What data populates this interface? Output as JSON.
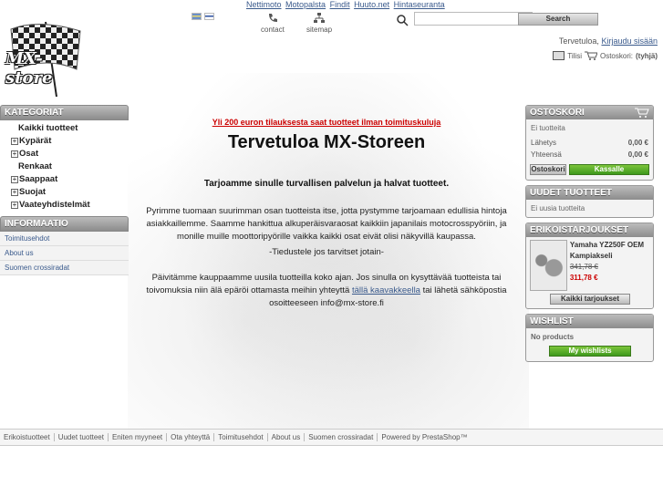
{
  "top_links": [
    "Nettimoto",
    "Motopalsta",
    "Findit",
    "Huuto.net",
    "Hintaseuranta"
  ],
  "top_icons": {
    "contact": "contact",
    "sitemap": "sitemap"
  },
  "logo_text": "MX-store",
  "search": {
    "value": "",
    "button": "Search"
  },
  "header": {
    "welcome": "Tervetuloa,",
    "login": "Kirjaudu sisään",
    "account": "Tilisi",
    "cart_label": "Ostoskori:",
    "cart_state": "(tyhjä)"
  },
  "left": {
    "categories_title": "KATEGORIAT",
    "categories": [
      {
        "label": "Kaikki tuotteet",
        "expand": false
      },
      {
        "label": "Kypärät",
        "expand": true
      },
      {
        "label": "Osat",
        "expand": true
      },
      {
        "label": "Renkaat",
        "expand": false
      },
      {
        "label": "Saappaat",
        "expand": true
      },
      {
        "label": "Suojat",
        "expand": true
      },
      {
        "label": "Vaateyhdistelmät",
        "expand": true
      }
    ],
    "info_title": "INFORMAATIO",
    "info": [
      "Toimitusehdot",
      "About us",
      "Suomen crossiradat"
    ]
  },
  "main": {
    "promo": "Yli 200 euron tilauksesta saat tuotteet ilman toimituskuluja",
    "title": "Tervetuloa MX-Storeen",
    "lead": "Tarjoamme sinulle turvallisen palvelun ja halvat tuotteet.",
    "para1": "Pyrimme tuomaan suurimman osan tuotteista itse, jotta pystymme tarjoamaan edullisia hintoja asiakkaillemme. Saamme hankittua alkuperäisvaraosat kaikkiin japanilais motocrosspyöriin, ja monille muille moottoripyörille vaikka kaikki osat eivät olisi näkyvillä kaupassa.",
    "para2": "-Tiedustele jos tarvitset jotain-",
    "para3a": "Päivitämme kauppaamme uusila tuotteilla koko ajan. Jos sinulla on kysyttävää tuotteista tai toivomuksia niin älä epäröi ottamasta meihin yhteyttä",
    "para3_link": "tällä kaavakkeella",
    "para3b": "tai lähetä sähköpostia osoitteeseen info@mx-store.fi"
  },
  "right": {
    "cart_title": "OSTOSKORI",
    "cart_empty": "Ei tuotteita",
    "shipping_label": "Lähetys",
    "shipping_value": "0,00 €",
    "total_label": "Yhteensä",
    "total_value": "0,00 €",
    "cart_btn": "Ostoskori",
    "checkout_btn": "Kassalle",
    "new_title": "UUDET TUOTTEET",
    "new_empty": "Ei uusia tuotteita",
    "specials_title": "ERIKOISTARJOUKSET",
    "special_name": "Yamaha YZ250F OEM Kampiakseli",
    "special_old": "341,78 €",
    "special_new": "311,78 €",
    "all_specials": "Kaikki tarjoukset",
    "wishlist_title": "WISHLIST",
    "wishlist_empty": "No products",
    "wishlist_btn": "My wishlists"
  },
  "footer": [
    "Erikoistuotteet",
    "Uudet tuotteet",
    "Eniten myyneet",
    "Ota yhteyttä",
    "Toimitusehdot",
    "About us",
    "Suomen crossiradat",
    "Powered by PrestaShop™"
  ]
}
